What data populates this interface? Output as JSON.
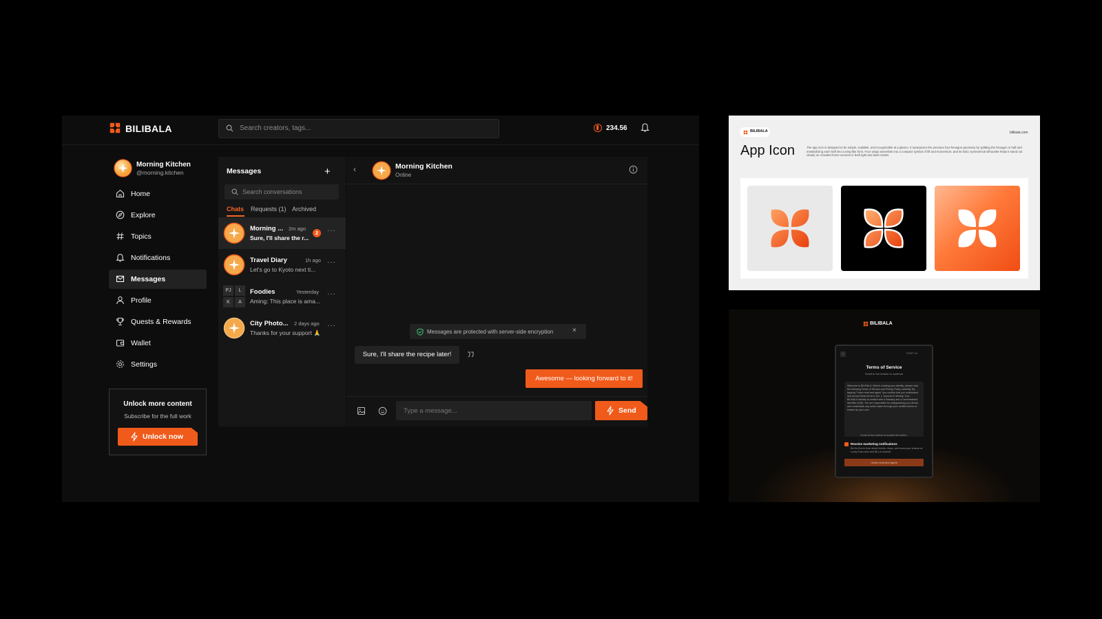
{
  "app": {
    "brand": "BILIBALA",
    "search_placeholder": "Search creators, tags...",
    "coin_balance": "234.56",
    "profile": {
      "name": "Morning Kitchen",
      "handle": "@morning.kitchen"
    },
    "nav": [
      {
        "label": "Home",
        "icon": "home-icon"
      },
      {
        "label": "Explore",
        "icon": "compass-icon"
      },
      {
        "label": "Topics",
        "icon": "hash-icon"
      },
      {
        "label": "Notifications",
        "icon": "bell-icon"
      },
      {
        "label": "Messages",
        "icon": "mail-icon",
        "active": true
      },
      {
        "label": "Profile",
        "icon": "user-icon"
      },
      {
        "label": "Quests & Rewards",
        "icon": "trophy-icon"
      },
      {
        "label": "Wallet",
        "icon": "wallet-icon"
      },
      {
        "label": "Settings",
        "icon": "gear-icon"
      }
    ],
    "unlock": {
      "title": "Unlock more content",
      "subtitle": "Subscribe for the full work",
      "button": "Unlock now"
    },
    "messages": {
      "title": "Messages",
      "search_placeholder": "Search conversations",
      "tabs": [
        "Chats",
        "Requests (1)",
        "Archived"
      ],
      "conversations": [
        {
          "name": "Morning ...",
          "time": "2m ago",
          "preview": "Sure, I'll share the r...",
          "unread": "2"
        },
        {
          "name": "Travel Diary",
          "time": "1h ago",
          "preview": "Let's go to Kyoto next ti..."
        },
        {
          "name": "Foodies",
          "time": "Yesterday",
          "preview": "Aming: This place is ama...",
          "group_initials": [
            "PJ",
            "L",
            "K",
            "A"
          ]
        },
        {
          "name": "City Photo...",
          "time": "2 days ago",
          "preview": "Thanks for your support 🙏"
        }
      ]
    },
    "chat": {
      "name": "Morning Kitchen",
      "status": "Online",
      "encryption_notice": "Messages are protected with server-side encryption",
      "incoming": "Sure, I'll share the recipe later!",
      "outgoing": "Awesome — looking forward to it!",
      "input_placeholder": "Type a message...",
      "send_label": "Send"
    }
  },
  "icon_panel": {
    "brand": "BILIBALA",
    "url": "bilibala.com",
    "title": "App Icon",
    "description": "The app icon is designed to be simple, scalable, and recognizable at a glance. It repurposes the previous four-hexagon geometry by splitting the hexagon in half and metabolizing each half into a wing-like form. Four wings assemble into a compact symbol of lift and momentum, and its bold, symmetrical silhouette helps it stand out clearly on crowded home screens in both light and dark modes."
  },
  "terms_panel": {
    "brand": "BILIBALA",
    "step": "STEP 1/3",
    "title": "Terms of Service",
    "subtitle": "Scroll to the bottom to continue",
    "body": "Welcome to BILIBALA. Before creating your identity, please read the following Terms of Service and Privacy Policy carefully. By tapping \"I have read and agree\" you confirm that you understand and accept these terms in full. 1. Account & Identity: Your BILIBALA identity is created with a Passkey and a Decentralized Identifier (DID). You are responsible for safeguarding your device and credentials; any action taken through your verified device is treated as your own.",
    "hint": "Scroll to the bottom to enable the button.",
    "checkbox_label": "Receive marketing notifications",
    "checkbox_desc": "Be the first to hear about events, drops, and boost your chance at Lucky Draw wins and BiLi-A rewards.",
    "button": "I have read and agree"
  },
  "colors": {
    "accent": "#f05a1a",
    "background": "#0d0d0d"
  }
}
